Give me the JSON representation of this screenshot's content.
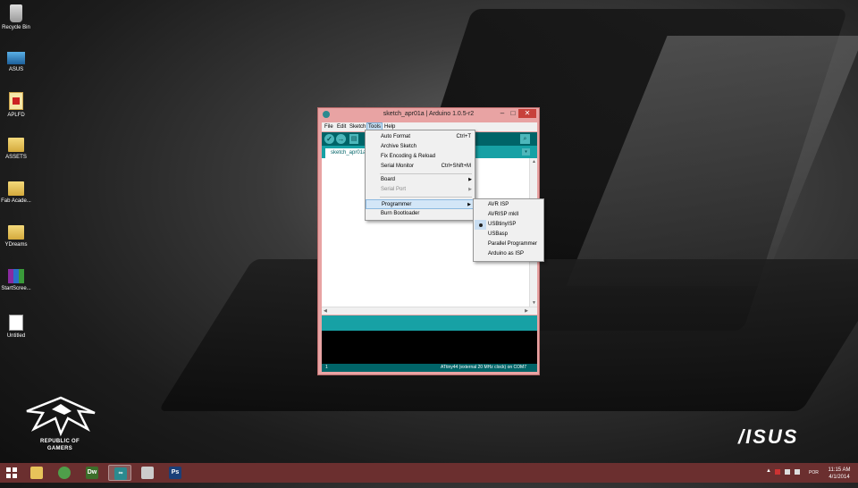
{
  "desktop": {
    "icons": [
      {
        "label": "Recycle Bin",
        "icon": "recycle-bin-icon"
      },
      {
        "label": "ASUS",
        "icon": "asus-app-icon"
      },
      {
        "label": "APLFD",
        "icon": "pdf-file-icon"
      },
      {
        "label": "ASSETS",
        "icon": "folder-icon"
      },
      {
        "label": "Fab Acade...",
        "icon": "folder-icon"
      },
      {
        "label": "YDreams",
        "icon": "folder-icon"
      },
      {
        "label": "StartScree...",
        "icon": "winrar-archive-icon"
      },
      {
        "label": "Untitled",
        "icon": "untitled-file-icon"
      }
    ],
    "branding": {
      "rog_line1": "REPUBLIC OF",
      "rog_line2": "GAMERS",
      "asus_logo": "/ISUS"
    }
  },
  "window": {
    "title": "sketch_apr01a | Arduino 1.0.5-r2",
    "controls": {
      "minimize": "–",
      "maximize": "□",
      "close": "✕"
    },
    "menubar": [
      "File",
      "Edit",
      "Sketch",
      "Tools",
      "Help"
    ],
    "active_menu": "Tools",
    "toolbar": {
      "verify": "✓",
      "upload": "→",
      "new": "▤",
      "serial": "⌕"
    },
    "tab_label": "sketch_apr01a",
    "tab_menu": "▾",
    "footer": {
      "line_number": "1",
      "board_info": "ATtiny44 (external 20 MHz clock) on COM7"
    }
  },
  "tools_menu": {
    "items": [
      {
        "label": "Auto Format",
        "shortcut": "Ctrl+T"
      },
      {
        "label": "Archive Sketch",
        "shortcut": ""
      },
      {
        "label": "Fix Encoding & Reload",
        "shortcut": ""
      },
      {
        "label": "Serial Monitor",
        "shortcut": "Ctrl+Shift+M"
      },
      {
        "label": "Board",
        "submenu": true
      },
      {
        "label": "Serial Port",
        "submenu": true,
        "disabled": true
      },
      {
        "label": "Programmer",
        "submenu": true,
        "highlighted": true
      },
      {
        "label": "Burn Bootloader",
        "shortcut": ""
      }
    ]
  },
  "programmer_menu": {
    "items": [
      "AVR ISP",
      "AVRISP mkII",
      "USBtinyISP",
      "USBasp",
      "Parallel Programmer",
      "Arduino as ISP"
    ],
    "selected": "USBtinyISP"
  },
  "taskbar": {
    "apps": [
      {
        "name": "file-explorer",
        "label": "",
        "color": "#e7c35a"
      },
      {
        "name": "chrome",
        "label": "",
        "color": "#4f9f4a"
      },
      {
        "name": "dreamweaver",
        "label": "Dw",
        "color": "#3c6e2a"
      },
      {
        "name": "arduino",
        "label": "∞",
        "color": "#2b8a8f",
        "active": true
      },
      {
        "name": "inkscape",
        "label": "",
        "color": "#cccccc"
      },
      {
        "name": "photoshop",
        "label": "Ps",
        "color": "#1b3f78"
      }
    ],
    "language": "POR",
    "time": "11:15 AM",
    "date": "4/1/2014"
  },
  "colors": {
    "arduino_dark_teal": "#006468",
    "arduino_teal": "#17a1a5",
    "window_frame": "#e8a3a3",
    "taskbar": "#6b2f2f",
    "close_button": "#c7413b"
  }
}
